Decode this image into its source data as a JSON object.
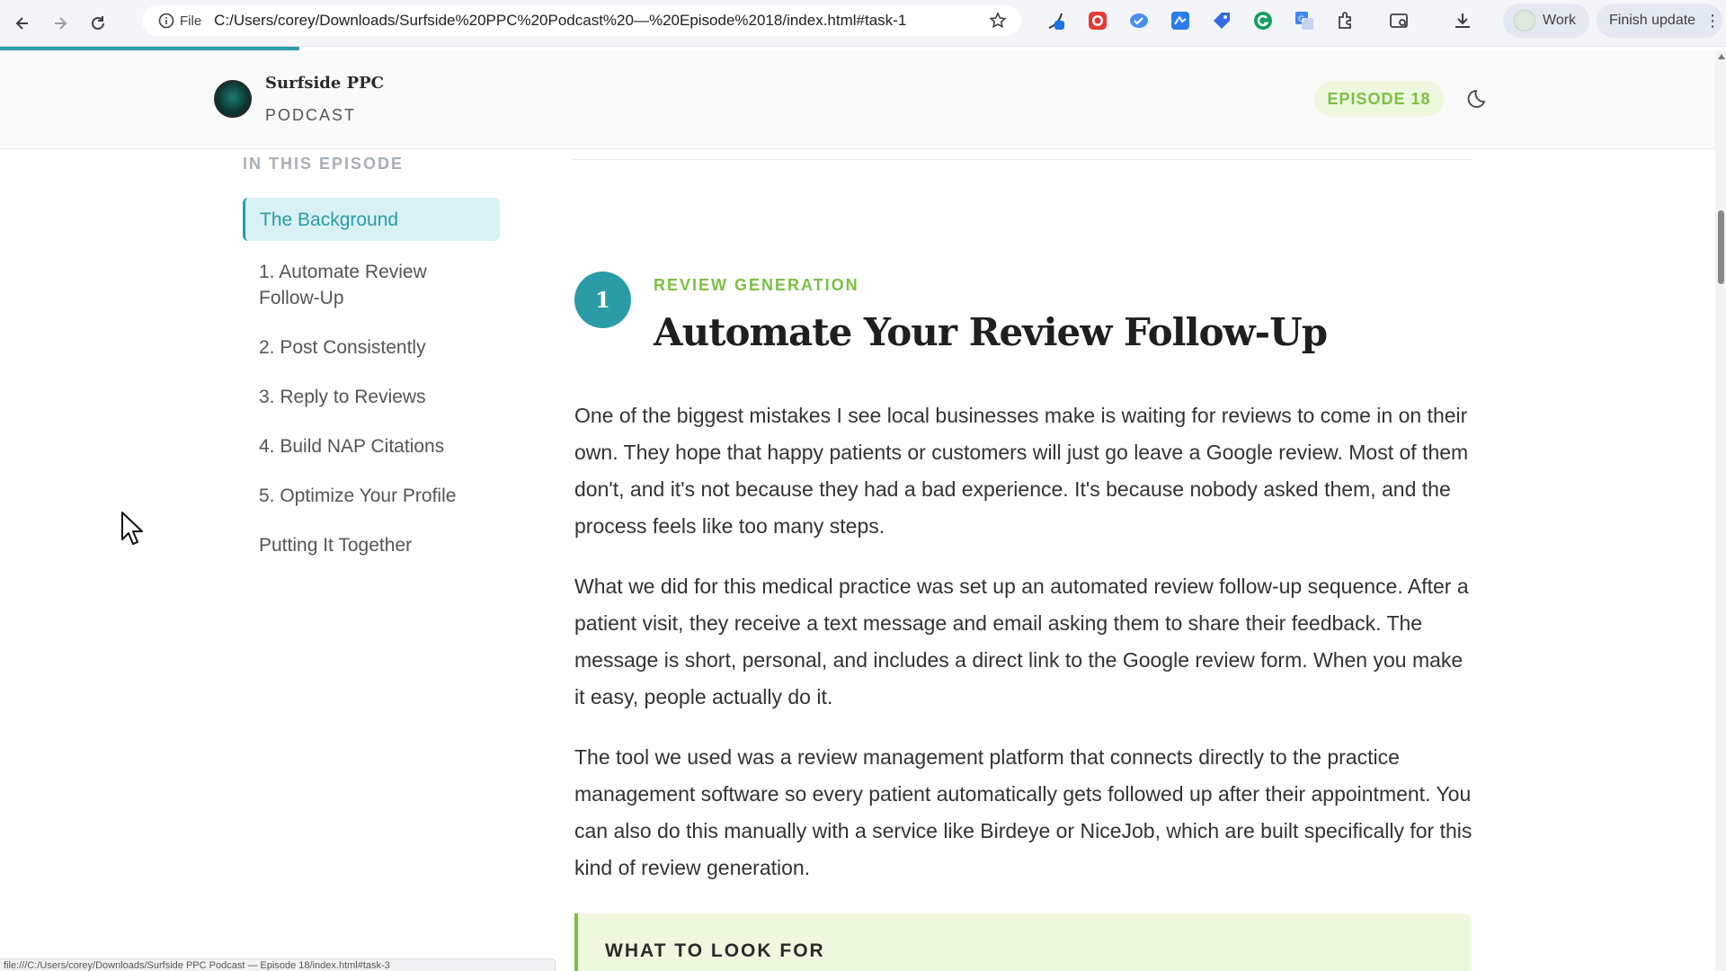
{
  "browser": {
    "site_info_label": "File",
    "url": "C:/Users/corey/Downloads/Surfside%20PPC%20Podcast%20—%20Episode%2018/index.html#task-1",
    "profile_label": "Work",
    "update_label": "Finish update",
    "status_url": "file:///C:/Users/corey/Downloads/Surfside PPC Podcast — Episode 18/index.html#task-3",
    "extensions": [
      "feather-extension-icon",
      "red-record-icon",
      "blue-check-icon",
      "blue-square-icon",
      "tag-icon",
      "grammarly-icon",
      "translate-icon",
      "puzzle-icon",
      "reader-mode-icon",
      "download-icon"
    ]
  },
  "header": {
    "brand_name": "Surfside PPC",
    "brand_sub": "PODCAST",
    "episode_badge": "EPISODE 18"
  },
  "toc": {
    "heading": "IN THIS EPISODE",
    "items": [
      {
        "label": "The Background"
      },
      {
        "label": "1. Automate Review Follow-Up"
      },
      {
        "label": "2. Post Consistently"
      },
      {
        "label": "3. Reply to Reviews"
      },
      {
        "label": "4. Build NAP Citations"
      },
      {
        "label": "5. Optimize Your Profile"
      },
      {
        "label": "Putting It Together"
      }
    ]
  },
  "section": {
    "number": "1",
    "kicker": "REVIEW GENERATION",
    "title": "Automate Your Review Follow-Up",
    "paragraphs": [
      "One of the biggest mistakes I see local businesses make is waiting for reviews to come in on their own. They hope that happy patients or customers will just go leave a Google review. Most of them don't, and it's not because they had a bad experience. It's because nobody asked them, and the process feels like too many steps.",
      "What we did for this medical practice was set up an automated review follow-up sequence. After a patient visit, they receive a text message and email asking them to share their feedback. The message is short, personal, and includes a direct link to the Google review form. When you make it easy, people actually do it.",
      "The tool we used was a review management platform that connects directly to the practice management software so every patient automatically gets followed up after their appointment. You can also do this manually with a service like Birdeye or NiceJob, which are built specifically for this kind of review generation."
    ],
    "callout_title": "WHAT TO LOOK FOR"
  },
  "colors": {
    "accent_teal": "#2a9ca6",
    "accent_green": "#7bc142",
    "badge_bg": "#eef8df"
  }
}
